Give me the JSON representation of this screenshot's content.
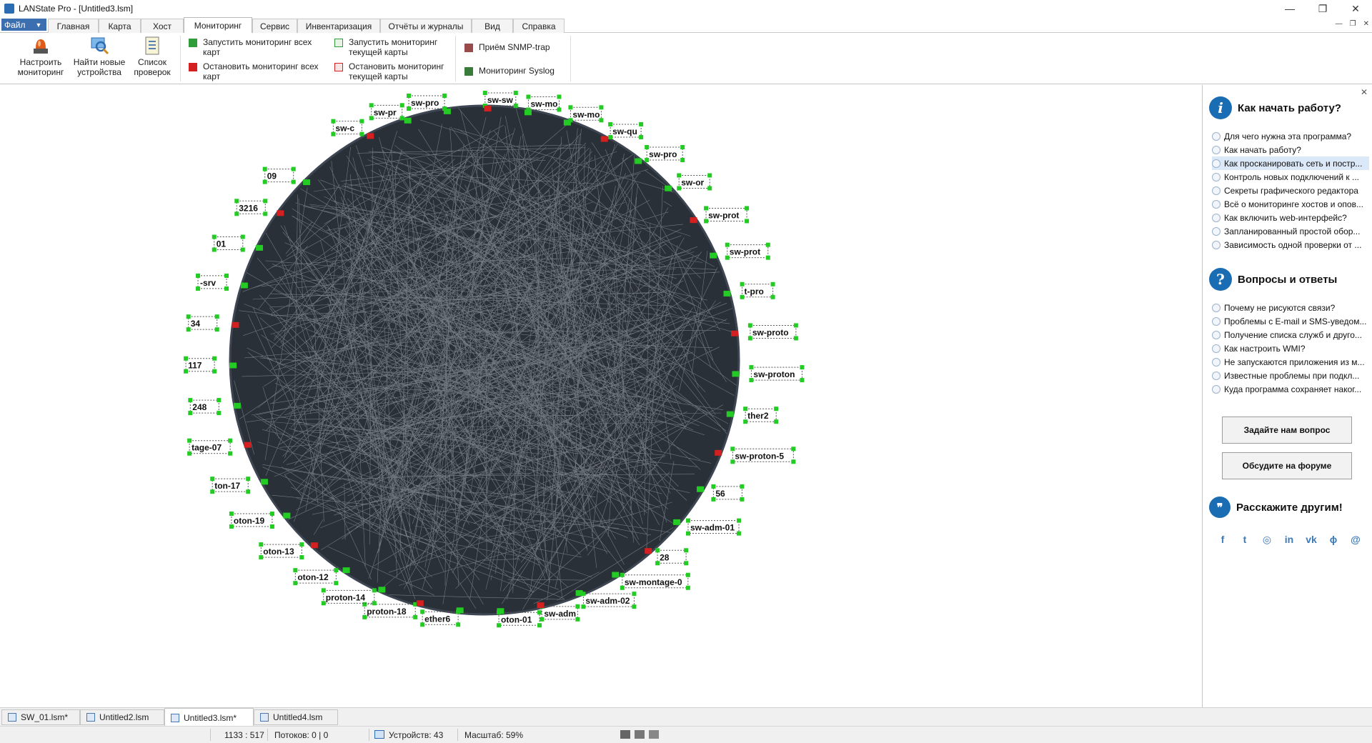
{
  "window": {
    "title": "LANState Pro - [Untitled3.lsm]",
    "minimize": "—",
    "restore": "❐",
    "close": "✕"
  },
  "menubar": {
    "file": "Файл",
    "tabs": [
      "Главная",
      "Карта",
      "Хост",
      "Мониторинг",
      "Сервис",
      "Инвентаризация",
      "Отчёты и журналы",
      "Вид",
      "Справка"
    ],
    "active_tab": "Мониторинг"
  },
  "ribbon": {
    "setup_monitoring": "Настроить мониторинг",
    "find_devices": "Найти новые устройства",
    "check_list": "Список проверок",
    "start_all": "Запустить мониторинг всех карт",
    "stop_all": "Остановить мониторинг всех карт",
    "start_current": "Запустить мониторинг текущей карты",
    "stop_current": "Остановить мониторинг текущей карты",
    "snmp_trap": "Приём SNMP-trap",
    "syslog": "Мониторинг Syslog"
  },
  "map": {
    "node_labels": [
      "sw-c",
      "sw-pr",
      "sw-pro",
      "sw-sw",
      "sw-mo",
      "sw-mo",
      "sw-qu",
      "sw-pro",
      "sw-or",
      "sw-prot",
      "sw-prot",
      "t-pro",
      "sw-proto",
      "sw-proton",
      "ther2",
      "sw-proton-5",
      "56",
      "sw-adm-01",
      "28",
      "sw-montage-0",
      "sw-adm-02",
      "sw-adm",
      "oton-01",
      "ether6",
      "proton-18",
      "proton-14",
      "oton-12",
      "oton-13",
      "oton-19",
      "ton-17",
      "tage-07",
      "248",
      "117",
      "34",
      "-srv",
      "01",
      "3216",
      "09"
    ]
  },
  "help_panel": {
    "start_title": "Как начать работу?",
    "start_items": [
      "Для чего нужна эта программа?",
      "Как начать работу?",
      "Как просканировать сеть и постр...",
      "Контроль новых подключений к ...",
      "Секреты графического редактора",
      "Всё о мониторинге хостов и опов...",
      "Как включить web-интерфейс?",
      "Запланированный простой обор...",
      "Зависимость одной проверки от ..."
    ],
    "faq_title": "Вопросы и ответы",
    "faq_items": [
      "Почему не рисуются связи?",
      "Проблемы с E-mail и SMS-уведом...",
      "Получение списка служб и друго...",
      "Как настроить WMI?",
      "Не запускаются приложения из м...",
      "Известные проблемы при подкл...",
      "Куда программа сохраняет наког..."
    ],
    "ask_button": "Задайте нам вопрос",
    "forum_button": "Обсудите на форуме",
    "share_title": "Расскажите другим!",
    "social_icons": [
      "facebook-icon",
      "twitter-icon",
      "odnoklassniki-icon",
      "linkedin-icon",
      "vk-icon",
      "moimir-icon",
      "email-icon"
    ],
    "social_glyphs": [
      "f",
      "t",
      "◎",
      "in",
      "vk",
      "ϕ",
      "@"
    ]
  },
  "doc_tabs": [
    "SW_01.lsm*",
    "Untitled2.lsm",
    "Untitled3.lsm*",
    "Untitled4.lsm"
  ],
  "active_doc_tab": "Untitled3.lsm*",
  "status": {
    "coords": "1133 : 517",
    "threads": "Потоков: 0 | 0",
    "devices": "Устройств: 43",
    "zoom": "Масштаб: 59%"
  },
  "colors": {
    "ok": "#22cc22",
    "alarm": "#d42020",
    "link": "#3d4652",
    "accent": "#3c6fb0"
  }
}
